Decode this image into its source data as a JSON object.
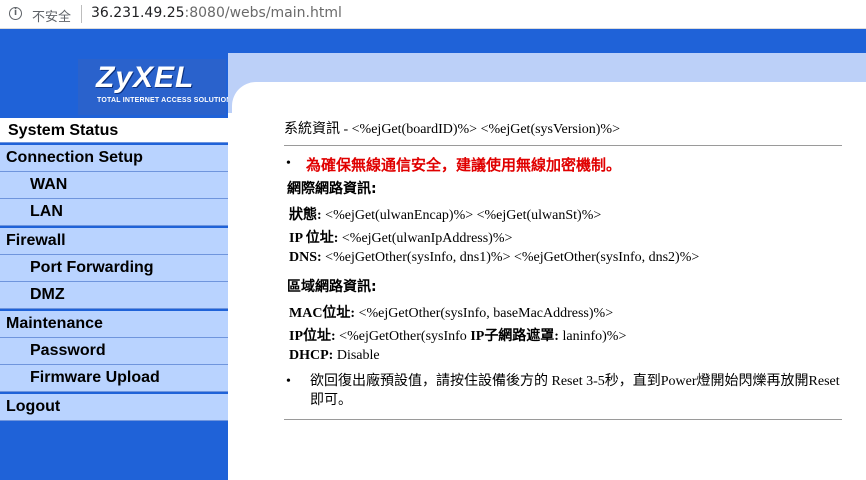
{
  "browser": {
    "security_label": "不安全",
    "url_host": "36.231.49.25",
    "url_path": ":8080/webs/main.html"
  },
  "brand": {
    "wordmark": "ZyXEL",
    "tagline": "TOTAL INTERNET ACCESS SOLUTION"
  },
  "menu": {
    "system_status": "System Status",
    "connection_setup": "Connection Setup",
    "wan": "WAN",
    "lan": "LAN",
    "firewall": "Firewall",
    "port_forwarding": "Port Forwarding",
    "dmz": "DMZ",
    "maintenance": "Maintenance",
    "password": "Password",
    "firmware_upload": "Firmware Upload",
    "logout": "Logout"
  },
  "content": {
    "sysinfo": "系統資訊 - <%ejGet(boardID)%>   <%ejGet(sysVersion)%>",
    "bullet": "•",
    "warning": "為確保無線通信安全，建議使用無線加密機制。",
    "wan_section": "網際網路資訊:",
    "wan_status_label": "狀態:",
    "wan_status_value": " <%ejGet(ulwanEncap)%>   <%ejGet(ulwanSt)%>",
    "wan_ip_label": "IP 位址:",
    "wan_ip_value": " <%ejGet(ulwanIpAddress)%>",
    "wan_dns_label": "DNS:",
    "wan_dns_value": " <%ejGetOther(sysInfo, dns1)%>    <%ejGetOther(sysInfo, dns2)%>",
    "lan_section": "區域網路資訊:",
    "lan_mac_label": "MAC位址:",
    "lan_mac_value": " <%ejGetOther(sysInfo, baseMacAddress)%>",
    "lan_ip_label": "IP位址:",
    "lan_ip_value": " <%ejGetOther(sysInfo    ",
    "lan_mask_label": "IP子網路遮罩:",
    "lan_mask_value": " laninfo)%>",
    "lan_dhcp_label": "DHCP:",
    "lan_dhcp_value": " Disable",
    "reset_note": "欲回復出廠預設值，請按住設備後方的 Reset 3-5秒，直到Power燈開始閃爍再放開Reset即可。"
  },
  "colors": {
    "frame_blue": "#1f62d8",
    "menu_bg": "#b9d3ff",
    "warning_red": "#e00000"
  }
}
